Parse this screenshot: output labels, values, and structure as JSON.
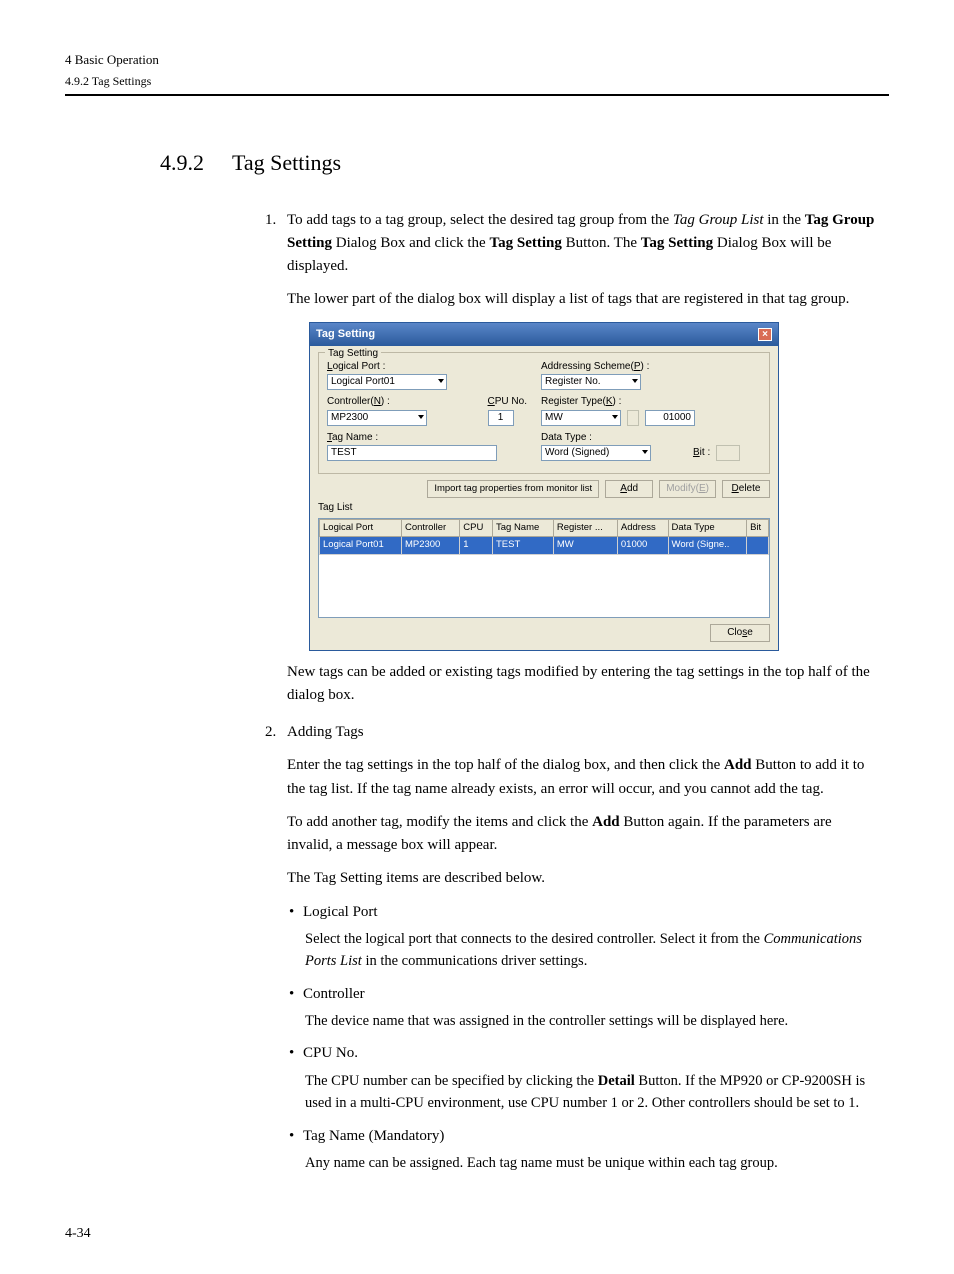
{
  "header": {
    "chapter": "4  Basic Operation",
    "sub": "4.9.2  Tag Settings"
  },
  "section": {
    "number": "4.9.2",
    "title": "Tag Settings"
  },
  "list": {
    "item1_a": "To add tags to a tag group, select the desired tag group from the ",
    "item1_b": "Tag Group List",
    "item1_c": " in the ",
    "item1_d": "Tag Group Setting",
    "item1_e": " Dialog Box and click the ",
    "item1_f": "Tag Setting",
    "item1_g": " Button. The ",
    "item1_h": "Tag Setting",
    "item1_i": " Dialog Box will be displayed.",
    "item1_p2": "The lower part of the dialog box will display a list of tags that are registered in that tag group.",
    "after_img": "New tags can be added or existing tags modified by entering the tag settings in the top half of the dialog box.",
    "item2_title": "Adding Tags",
    "item2_p1_a": "Enter the tag settings in the top half of the dialog box, and then click the ",
    "item2_p1_b": "Add",
    "item2_p1_c": " Button to add it to the tag list. If the tag name already exists, an error will occur, and you cannot add the tag.",
    "item2_p2_a": "To add another tag, modify the items and click the ",
    "item2_p2_b": "Add",
    "item2_p2_c": " Button again. If the parameters are invalid, a message box will appear.",
    "item2_p3": "The Tag Setting items are described below.",
    "b1_t": "Logical Port",
    "b1_a": "Select the logical port that connects to the desired controller. Select it from the ",
    "b1_b": "Communications Ports List",
    "b1_c": " in the communications driver settings.",
    "b2_t": "Controller",
    "b2_a": "The device name that was assigned in the controller settings will be displayed here.",
    "b3_t": "CPU No.",
    "b3_a": "The CPU number can be specified by clicking the ",
    "b3_b": "Detail",
    "b3_c": " Button. If the MP920 or CP-9200SH is used in a multi-CPU environment, use CPU number 1 or 2. Other controllers should be set to 1.",
    "b4_t": "Tag Name (Mandatory)",
    "b4_a": "Any name can be assigned. Each tag name must be unique within each tag group."
  },
  "dialog": {
    "title": "Tag Setting",
    "close_x": "×",
    "group_title": "Tag Setting",
    "logical_port_lbl_pre": "L",
    "logical_port_lbl": "ogical Port :",
    "logical_port_val": "Logical Port01",
    "controller_lbl_pre1": "Controller(",
    "controller_lbl_u": "N",
    "controller_lbl_post": ") :",
    "controller_val": "MP2300",
    "cpu_lbl_pre": "C",
    "cpu_lbl": "PU No.",
    "cpu_val": "1",
    "tagname_lbl_pre": "T",
    "tagname_lbl": "ag Name :",
    "tagname_val": "TEST",
    "addr_scheme_lbl_pre": "Addressing Scheme(",
    "addr_scheme_lbl_u": "P",
    "addr_scheme_lbl_post": ") :",
    "addr_scheme_val": "Register No.",
    "regtype_lbl_pre": "Register Type(",
    "regtype_lbl_u": "K",
    "regtype_lbl_post": ") :",
    "regtype_val": "MW",
    "address_val": "01000",
    "datatype_lbl": "Data Type :",
    "datatype_val": "Word (Signed)",
    "bit_lbl_pre": "B",
    "bit_lbl": "it :",
    "import_btn": "Import tag properties from monitor list",
    "add_btn_pre": "A",
    "add_btn": "dd",
    "modify_btn_pre": "Modify(",
    "modify_btn_u": "E",
    "modify_btn_post": ")",
    "delete_btn_pre": "D",
    "delete_btn": "elete",
    "taglist_lbl": "Tag List",
    "cols": {
      "c1": "Logical Port",
      "c2": "Controller",
      "c3": "CPU",
      "c4": "Tag Name",
      "c5": "Register ...",
      "c6": "Address",
      "c7": "Data Type",
      "c8": "Bit"
    },
    "row": {
      "c1": "Logical Port01",
      "c2": "MP2300",
      "c3": "1",
      "c4": "TEST",
      "c5": "MW",
      "c6": "01000",
      "c7": "Word (Signe..",
      "c8": ""
    },
    "close_btn_pre": "Clo",
    "close_btn_u": "s",
    "close_btn_post": "e"
  },
  "page_number": "4-34"
}
